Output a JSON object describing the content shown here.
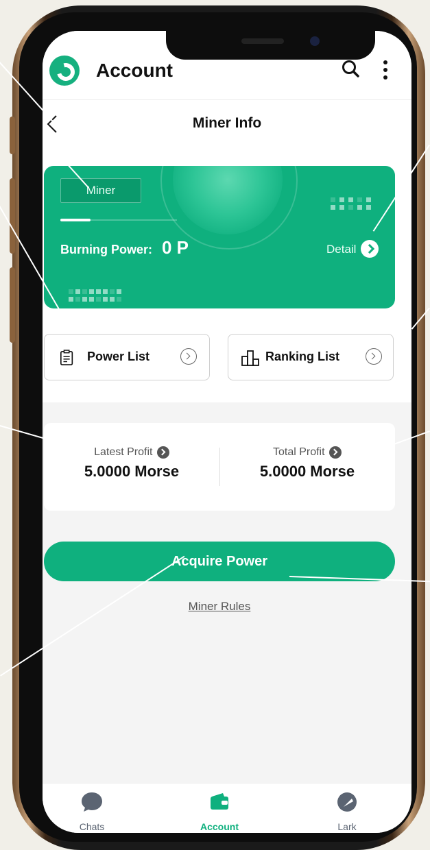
{
  "header": {
    "title": "Account"
  },
  "subheader": {
    "title": "Miner Info"
  },
  "miner_card": {
    "tag": "Miner",
    "progress": 0.26,
    "burning_power_label": "Burning Power:",
    "burning_power_value": "0 P",
    "detail_label": "Detail"
  },
  "lists": {
    "power_list": "Power List",
    "ranking_list": "Ranking List"
  },
  "profit": {
    "latest_label": "Latest Profit",
    "latest_value": "5.0000 Morse",
    "total_label": "Total Profit",
    "total_value": "5.0000 Morse"
  },
  "actions": {
    "acquire_power": "Acquire Power",
    "miner_rules": "Miner Rules"
  },
  "tabbar": {
    "items": [
      {
        "label": "Chats",
        "icon": "chat-bubble-icon",
        "active": false
      },
      {
        "label": "Account",
        "icon": "wallet-icon",
        "active": true
      },
      {
        "label": "Lark",
        "icon": "lark-icon",
        "active": false
      }
    ]
  },
  "colors": {
    "accent": "#0fb07e",
    "inactive": "#5b6472",
    "background": "#f4f4f4"
  }
}
